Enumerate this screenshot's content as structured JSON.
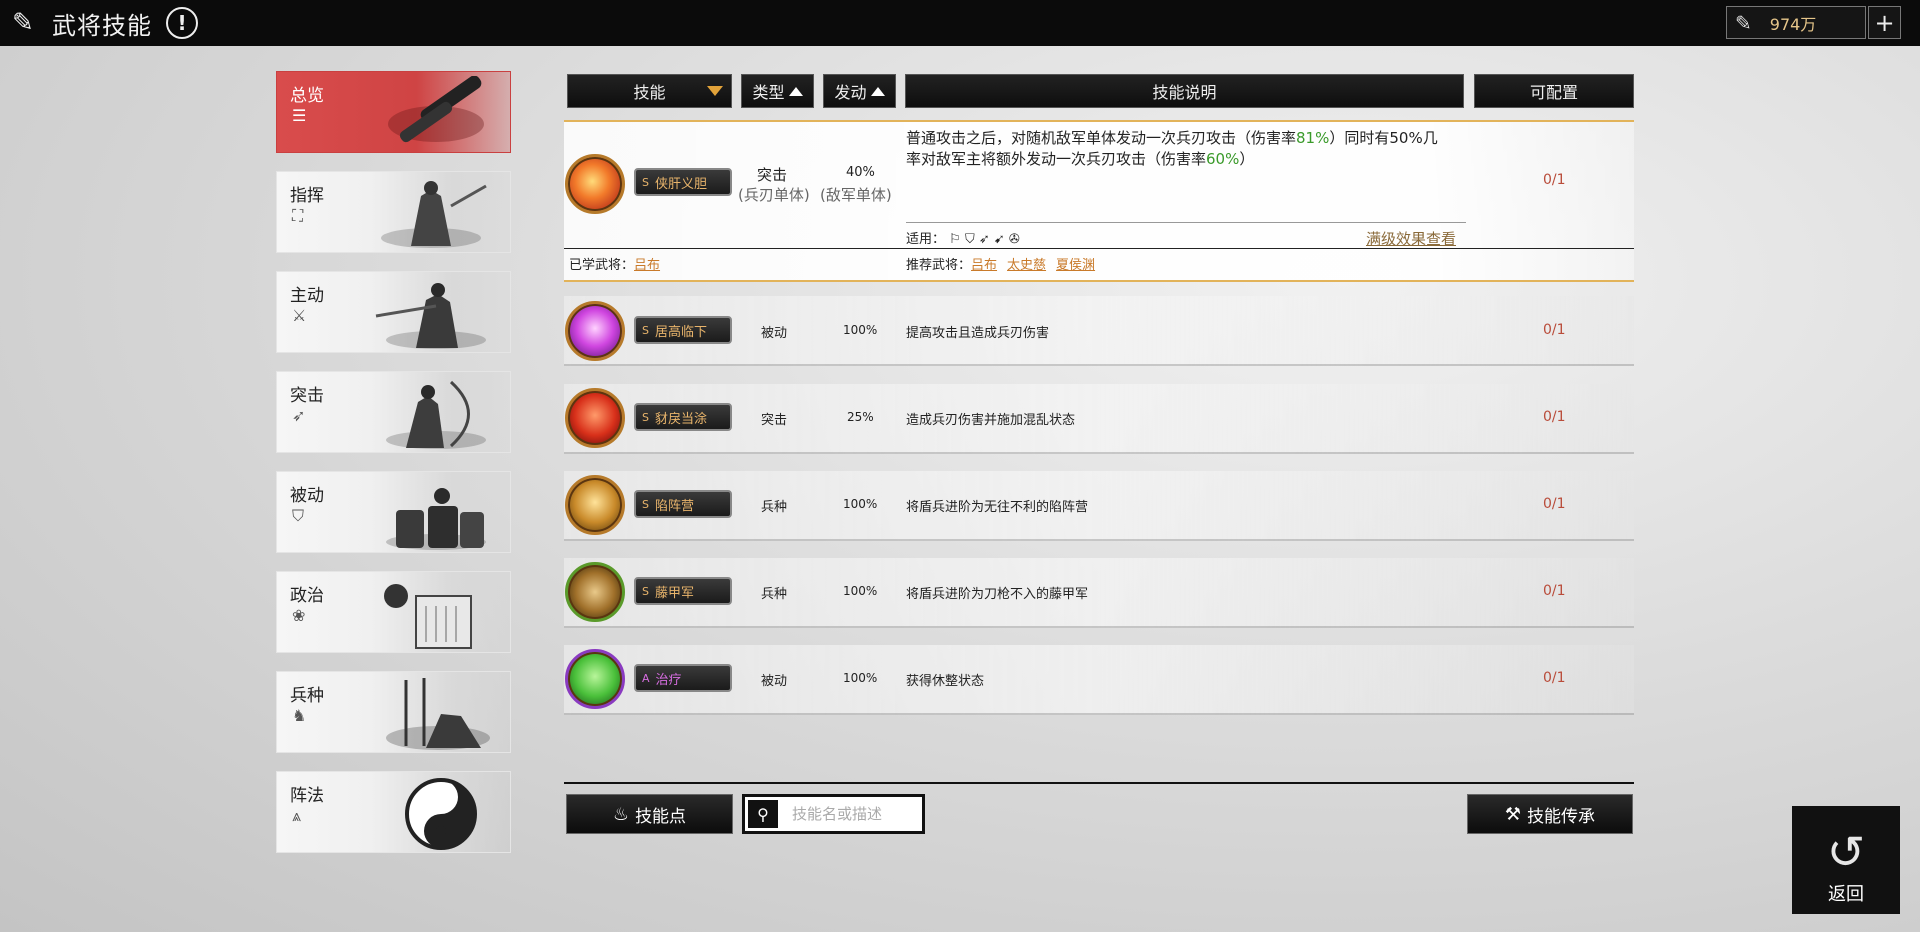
{
  "header": {
    "title": "武将技能",
    "info_symbol": "!",
    "currency": "974万",
    "plus": "+"
  },
  "sidebar": {
    "items": [
      {
        "label": "总览",
        "icon": "list-icon",
        "symbol": "☰"
      },
      {
        "label": "指挥",
        "icon": "command-icon",
        "symbol": "⛶"
      },
      {
        "label": "主动",
        "icon": "active-icon",
        "symbol": "⚔"
      },
      {
        "label": "突击",
        "icon": "assault-icon",
        "symbol": "➶"
      },
      {
        "label": "被动",
        "icon": "passive-icon",
        "symbol": "⛉"
      },
      {
        "label": "政治",
        "icon": "politics-icon",
        "symbol": "❀"
      },
      {
        "label": "兵种",
        "icon": "troop-icon",
        "symbol": "♞"
      },
      {
        "label": "阵法",
        "icon": "formation-icon",
        "symbol": "⩓"
      }
    ]
  },
  "table": {
    "headers": {
      "skill": "技能",
      "type": "类型",
      "trigger": "发动",
      "desc": "技能说明",
      "config": "可配置"
    },
    "expanded": {
      "grade": "S",
      "name": "侠肝义胆",
      "type": "突击",
      "type_sub": "(兵刃单体)",
      "trigger": "40%",
      "trigger_sub": "(敌军单体)",
      "desc_a": "普通攻击之后，对随机敌军单体发动一次兵刃攻击（伤害率",
      "desc_b": "81%",
      "desc_c": "）同时有50%几",
      "desc_d": "率对敌军主将额外发动一次兵刃攻击（伤害率",
      "desc_e": "60%",
      "desc_f": "）",
      "apply_label": "适用：",
      "apply_icons": "⚐ ⛉ ➶ ➹ ✇",
      "full_effect": "满级效果查看",
      "learned_label": "已学武将：",
      "learned": "吕布",
      "recommend_label": "推荐武将：",
      "recommend": [
        "吕布",
        "太史慈",
        "夏侯渊"
      ],
      "config": "0/1"
    },
    "rows": [
      {
        "grade": "S",
        "name": "居高临下",
        "type": "被动",
        "trigger": "100%",
        "desc": "提高攻击且造成兵刃伤害",
        "config": "0/1"
      },
      {
        "grade": "S",
        "name": "豺戾当涂",
        "type": "突击",
        "trigger": "25%",
        "desc": "造成兵刃伤害并施加混乱状态",
        "config": "0/1"
      },
      {
        "grade": "S",
        "name": "陷阵营",
        "type": "兵种",
        "trigger": "100%",
        "desc": "将盾兵进阶为无往不利的陷阵营",
        "config": "0/1"
      },
      {
        "grade": "S",
        "name": "藤甲军",
        "type": "兵种",
        "trigger": "100%",
        "desc": "将盾兵进阶为刀枪不入的藤甲军",
        "config": "0/1"
      },
      {
        "grade": "A",
        "name": "治疗",
        "type": "被动",
        "trigger": "100%",
        "desc": "获得休整状态",
        "config": "0/1"
      }
    ]
  },
  "bottom": {
    "skill_points": "技能点",
    "search_placeholder": "技能名或描述",
    "inherit": "技能传承",
    "back": "返回"
  },
  "colors": {
    "active_tab": "#d94c4c",
    "accent_gold": "#e2b35a",
    "config_red": "#b94c3a"
  }
}
